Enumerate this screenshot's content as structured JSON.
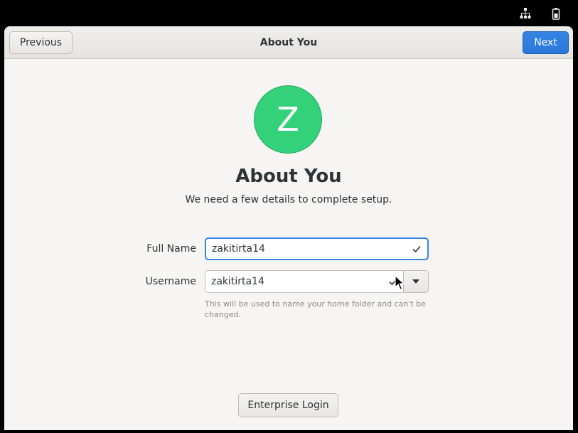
{
  "topbar": {
    "network_icon": "network-wired-icon",
    "battery_icon": "battery-icon"
  },
  "header": {
    "previous_label": "Previous",
    "title": "About You",
    "next_label": "Next"
  },
  "avatar": {
    "initial": "Z",
    "color": "#33d17a"
  },
  "main": {
    "title": "About You",
    "subtitle": "We need a few details to complete setup."
  },
  "form": {
    "fullname_label": "Full Name",
    "fullname_value": "zakitirta14",
    "username_label": "Username",
    "username_value": "zakitirta14",
    "username_hint": "This will be used to name your home folder and can't be changed."
  },
  "footer": {
    "enterprise_label": "Enterprise Login"
  },
  "colors": {
    "accent": "#3584e4",
    "window_bg": "#f6f5f4"
  }
}
